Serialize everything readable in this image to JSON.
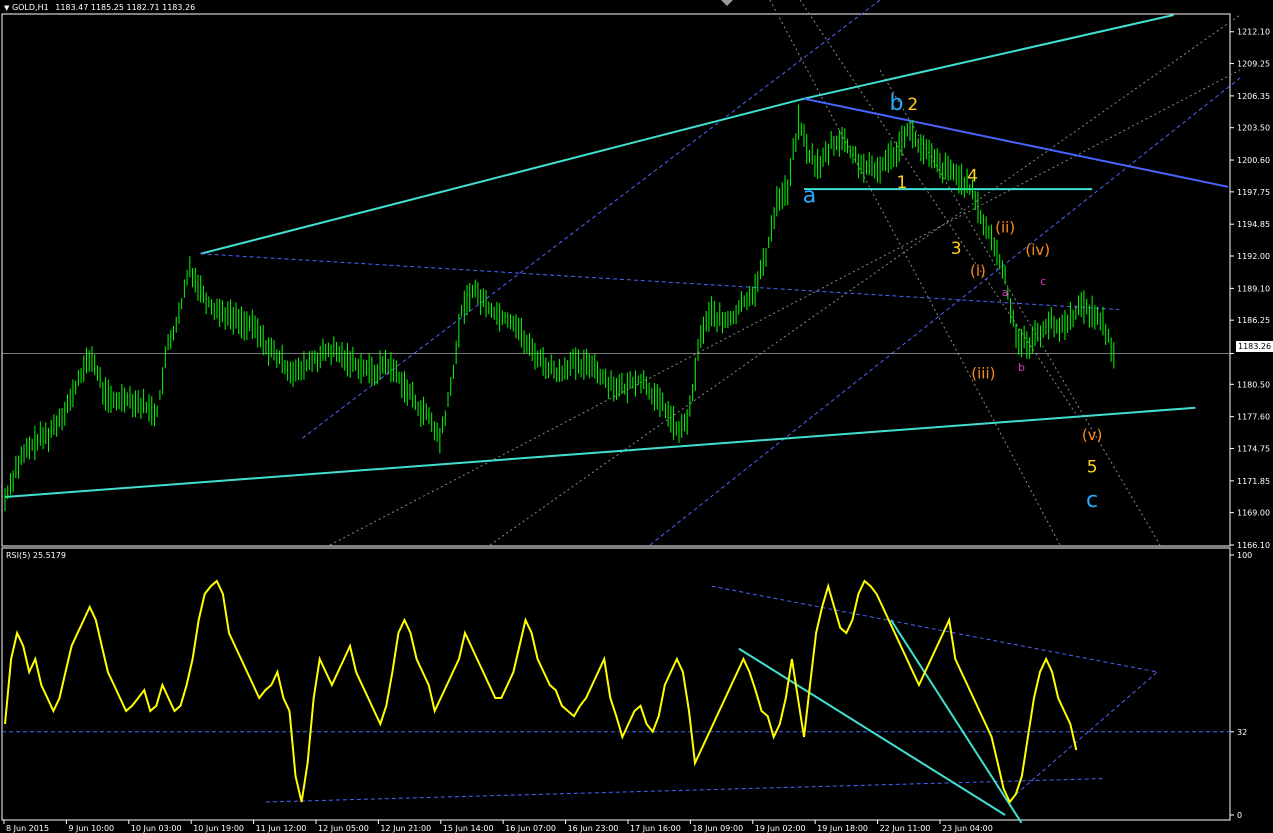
{
  "header": {
    "symbol": "GOLD,H1",
    "ohlc": "1183.47 1185.25 1182.71 1183.26",
    "rsi_label": "RSI(5) 25.5179"
  },
  "colors": {
    "background": "#000000",
    "candle": "#00ff00",
    "trend_cyan": "#40e0d0",
    "channel_blue": "#4a64ff",
    "rsi": "#ffff00",
    "fib_grey": "#8a8a8a",
    "wave_cyan": "#29a9ff",
    "wave_yellow": "#ffd21e",
    "wave_orange": "#ff8c1a",
    "wave_magenta": "#d23cd2"
  },
  "chart_data": [
    {
      "type": "candlestick",
      "title": "GOLD,H1",
      "ylim": [
        1166.1,
        1213.6
      ],
      "y_ticks": [
        "1212.10",
        "1209.25",
        "1206.35",
        "1203.50",
        "1200.60",
        "1197.75",
        "1194.85",
        "1192.00",
        "1189.10",
        "1186.25",
        "1183.26",
        "1180.50",
        "1177.60",
        "1174.75",
        "1171.85",
        "1169.00",
        "1166.10"
      ],
      "last_price": "1183.26",
      "x_ticks": [
        "8 Jun 2015",
        "9 Jun 10:00",
        "10 Jun 03:00",
        "10 Jun 19:00",
        "11 Jun 12:00",
        "12 Jun 05:00",
        "12 Jun 21:00",
        "15 Jun 14:00",
        "16 Jun 07:00",
        "16 Jun 23:00",
        "17 Jun 16:00",
        "18 Jun 09:00",
        "19 Jun 02:00",
        "19 Jun 18:00",
        "22 Jun 11:00",
        "23 Jun 04:00"
      ],
      "price_path": [
        [
          0,
          1170.2
        ],
        [
          2,
          1173
        ],
        [
          4,
          1174.5
        ],
        [
          6,
          1175.5
        ],
        [
          8,
          1176
        ],
        [
          10,
          1177.5
        ],
        [
          12,
          1179
        ],
        [
          14,
          1181.5
        ],
        [
          16,
          1183
        ],
        [
          18,
          1180
        ],
        [
          20,
          1178.8
        ],
        [
          22,
          1179.5
        ],
        [
          24,
          1179
        ],
        [
          26,
          1178.5
        ],
        [
          28,
          1178
        ],
        [
          30,
          1184
        ],
        [
          32,
          1186.5
        ],
        [
          34,
          1191
        ],
        [
          36,
          1189
        ],
        [
          38,
          1187.5
        ],
        [
          40,
          1187
        ],
        [
          42,
          1186.5
        ],
        [
          44,
          1186
        ],
        [
          46,
          1185.5
        ],
        [
          48,
          1184
        ],
        [
          50,
          1183
        ],
        [
          52,
          1182
        ],
        [
          54,
          1181.5
        ],
        [
          56,
          1182.5
        ],
        [
          58,
          1183
        ],
        [
          60,
          1183.5
        ],
        [
          62,
          1183
        ],
        [
          64,
          1182.5
        ],
        [
          66,
          1182
        ],
        [
          68,
          1181.5
        ],
        [
          70,
          1182.5
        ],
        [
          72,
          1181.5
        ],
        [
          74,
          1180
        ],
        [
          76,
          1178.5
        ],
        [
          78,
          1177.5
        ],
        [
          80,
          1175.5
        ],
        [
          82,
          1180
        ],
        [
          84,
          1187
        ],
        [
          86,
          1189
        ],
        [
          88,
          1188
        ],
        [
          90,
          1187
        ],
        [
          92,
          1186.5
        ],
        [
          94,
          1186
        ],
        [
          96,
          1184
        ],
        [
          98,
          1183
        ],
        [
          100,
          1182
        ],
        [
          102,
          1181.5
        ],
        [
          104,
          1182.5
        ],
        [
          106,
          1182
        ],
        [
          108,
          1182.5
        ],
        [
          110,
          1181
        ],
        [
          112,
          1180.5
        ],
        [
          114,
          1180
        ],
        [
          116,
          1181
        ],
        [
          118,
          1180.5
        ],
        [
          120,
          1179
        ],
        [
          122,
          1178
        ],
        [
          124,
          1176
        ],
        [
          126,
          1178
        ],
        [
          128,
          1185
        ],
        [
          130,
          1187
        ],
        [
          132,
          1186
        ],
        [
          134,
          1186.5
        ],
        [
          136,
          1188
        ],
        [
          138,
          1189
        ],
        [
          140,
          1192
        ],
        [
          142,
          1197
        ],
        [
          144,
          1198
        ],
        [
          146,
          1204
        ],
        [
          148,
          1201
        ],
        [
          150,
          1200
        ],
        [
          152,
          1202
        ],
        [
          154,
          1202.5
        ],
        [
          156,
          1201
        ],
        [
          158,
          1200
        ],
        [
          160,
          1199.5
        ],
        [
          162,
          1200.5
        ],
        [
          164,
          1201.5
        ],
        [
          166,
          1203.5
        ],
        [
          168,
          1202
        ],
        [
          170,
          1201
        ],
        [
          172,
          1200
        ],
        [
          174,
          1199.5
        ],
        [
          176,
          1199
        ],
        [
          178,
          1197.5
        ],
        [
          180,
          1195
        ],
        [
          182,
          1193
        ],
        [
          184,
          1190
        ],
        [
          186,
          1185
        ],
        [
          188,
          1184
        ],
        [
          190,
          1185
        ],
        [
          192,
          1186
        ],
        [
          194,
          1185.5
        ],
        [
          196,
          1186.5
        ],
        [
          198,
          1187.5
        ],
        [
          200,
          1187
        ],
        [
          202,
          1186
        ],
        [
          204,
          1183.3
        ]
      ],
      "trendlines": [
        {
          "from": [
            0,
            1170.4
          ],
          "to": [
            219,
            1178.4
          ],
          "style": "solid",
          "color": "trend_cyan"
        },
        {
          "from": [
            36,
            1192.2
          ],
          "to": [
            147,
            1206.1
          ],
          "style": "solid",
          "color": "trend_cyan"
        },
        {
          "from": [
            147,
            1206.1
          ],
          "to": [
            215,
            1213.6
          ],
          "style": "solid",
          "color": "trend_cyan"
        },
        {
          "from": [
            147,
            1198.0
          ],
          "to": [
            200,
            1198.0
          ],
          "style": "solid",
          "color": "trend_cyan"
        },
        {
          "from": [
            147,
            1206.1
          ],
          "to": [
            225,
            1198.2
          ],
          "style": "solid",
          "color": "channel_blue"
        },
        {
          "from": [
            36,
            1192.2
          ],
          "to": [
            205,
            1187.2
          ],
          "style": "dashed",
          "color": "channel_blue"
        }
      ],
      "annotations": [
        {
          "text": "a",
          "x": 148,
          "y": 1196.8,
          "color": "wave_cyan",
          "size": "large"
        },
        {
          "text": "b",
          "x": 164,
          "y": 1205.1,
          "color": "wave_cyan",
          "size": "large"
        },
        {
          "text": "2",
          "x": 167,
          "y": 1205.1,
          "color": "wave_yellow",
          "size": "medium"
        },
        {
          "text": "1",
          "x": 165,
          "y": 1198.1,
          "color": "wave_yellow",
          "size": "medium"
        },
        {
          "text": "4",
          "x": 178,
          "y": 1198.7,
          "color": "wave_yellow",
          "size": "medium"
        },
        {
          "text": "3",
          "x": 175,
          "y": 1192.2,
          "color": "wave_yellow",
          "size": "medium"
        },
        {
          "text": "(ii)",
          "x": 184,
          "y": 1194.1,
          "color": "wave_orange",
          "size": "small"
        },
        {
          "text": "(i)",
          "x": 179,
          "y": 1190.2,
          "color": "wave_orange",
          "size": "small"
        },
        {
          "text": "(iv)",
          "x": 190,
          "y": 1192.1,
          "color": "wave_orange",
          "size": "small"
        },
        {
          "text": "a",
          "x": 184,
          "y": 1188.4,
          "color": "wave_magenta",
          "size": "tiny"
        },
        {
          "text": "c",
          "x": 191,
          "y": 1189.4,
          "color": "wave_magenta",
          "size": "tiny"
        },
        {
          "text": "(iii)",
          "x": 180,
          "y": 1181.0,
          "color": "wave_orange",
          "size": "small"
        },
        {
          "text": "b",
          "x": 187,
          "y": 1181.7,
          "color": "wave_magenta",
          "size": "tiny"
        },
        {
          "text": "(v)",
          "x": 200,
          "y": 1175.5,
          "color": "wave_orange",
          "size": "small"
        },
        {
          "text": "5",
          "x": 200,
          "y": 1172.6,
          "color": "wave_yellow",
          "size": "medium"
        },
        {
          "text": "c",
          "x": 200,
          "y": 1169.5,
          "color": "wave_cyan",
          "size": "large"
        }
      ]
    },
    {
      "type": "line",
      "title": "RSI(5) 25.5179",
      "ylim": [
        0,
        100
      ],
      "y_ticks": [
        "100",
        "32",
        "0"
      ],
      "level_line": 32,
      "series": [
        {
          "name": "RSI(5)",
          "values": [
            35,
            60,
            70,
            65,
            55,
            60,
            50,
            45,
            40,
            45,
            55,
            65,
            70,
            75,
            80,
            75,
            65,
            55,
            50,
            45,
            40,
            42,
            45,
            48,
            40,
            42,
            50,
            45,
            40,
            42,
            50,
            60,
            75,
            85,
            88,
            90,
            85,
            70,
            65,
            60,
            55,
            50,
            45,
            48,
            50,
            55,
            45,
            40,
            15,
            5,
            20,
            45,
            60,
            55,
            50,
            55,
            60,
            65,
            55,
            50,
            45,
            40,
            35,
            42,
            55,
            70,
            75,
            70,
            60,
            55,
            50,
            40,
            45,
            50,
            55,
            60,
            70,
            65,
            60,
            55,
            50,
            45,
            45,
            50,
            55,
            65,
            75,
            70,
            60,
            55,
            50,
            48,
            42,
            40,
            38,
            42,
            45,
            50,
            55,
            60,
            45,
            38,
            30,
            35,
            40,
            42,
            35,
            32,
            38,
            50,
            55,
            60,
            55,
            40,
            20,
            25,
            30,
            35,
            40,
            45,
            50,
            55,
            60,
            55,
            48,
            40,
            38,
            30,
            35,
            45,
            60,
            45,
            30,
            50,
            70,
            80,
            88,
            80,
            72,
            70,
            75,
            85,
            90,
            88,
            85,
            80,
            75,
            70,
            65,
            60,
            55,
            50,
            55,
            60,
            65,
            70,
            75,
            60,
            55,
            50,
            45,
            40,
            35,
            30,
            20,
            10,
            5,
            8,
            15,
            30,
            45,
            55,
            60,
            55,
            45,
            40,
            35,
            25
          ]
        }
      ],
      "trendlines": [
        {
          "from": [
            130,
            88
          ],
          "to": [
            212,
            55
          ],
          "style": "dashed",
          "color": "channel_blue"
        },
        {
          "from": [
            48,
            5
          ],
          "to": [
            202,
            14
          ],
          "style": "dashed",
          "color": "channel_blue"
        },
        {
          "from": [
            135,
            64
          ],
          "to": [
            184,
            0
          ],
          "style": "solid",
          "color": "trend_cyan"
        },
        {
          "from": [
            163,
            75
          ],
          "to": [
            187,
            -3
          ],
          "style": "solid",
          "color": "trend_cyan"
        },
        {
          "from": [
            186,
            8
          ],
          "to": [
            212,
            55
          ],
          "style": "dashed",
          "color": "channel_blue"
        }
      ]
    }
  ]
}
